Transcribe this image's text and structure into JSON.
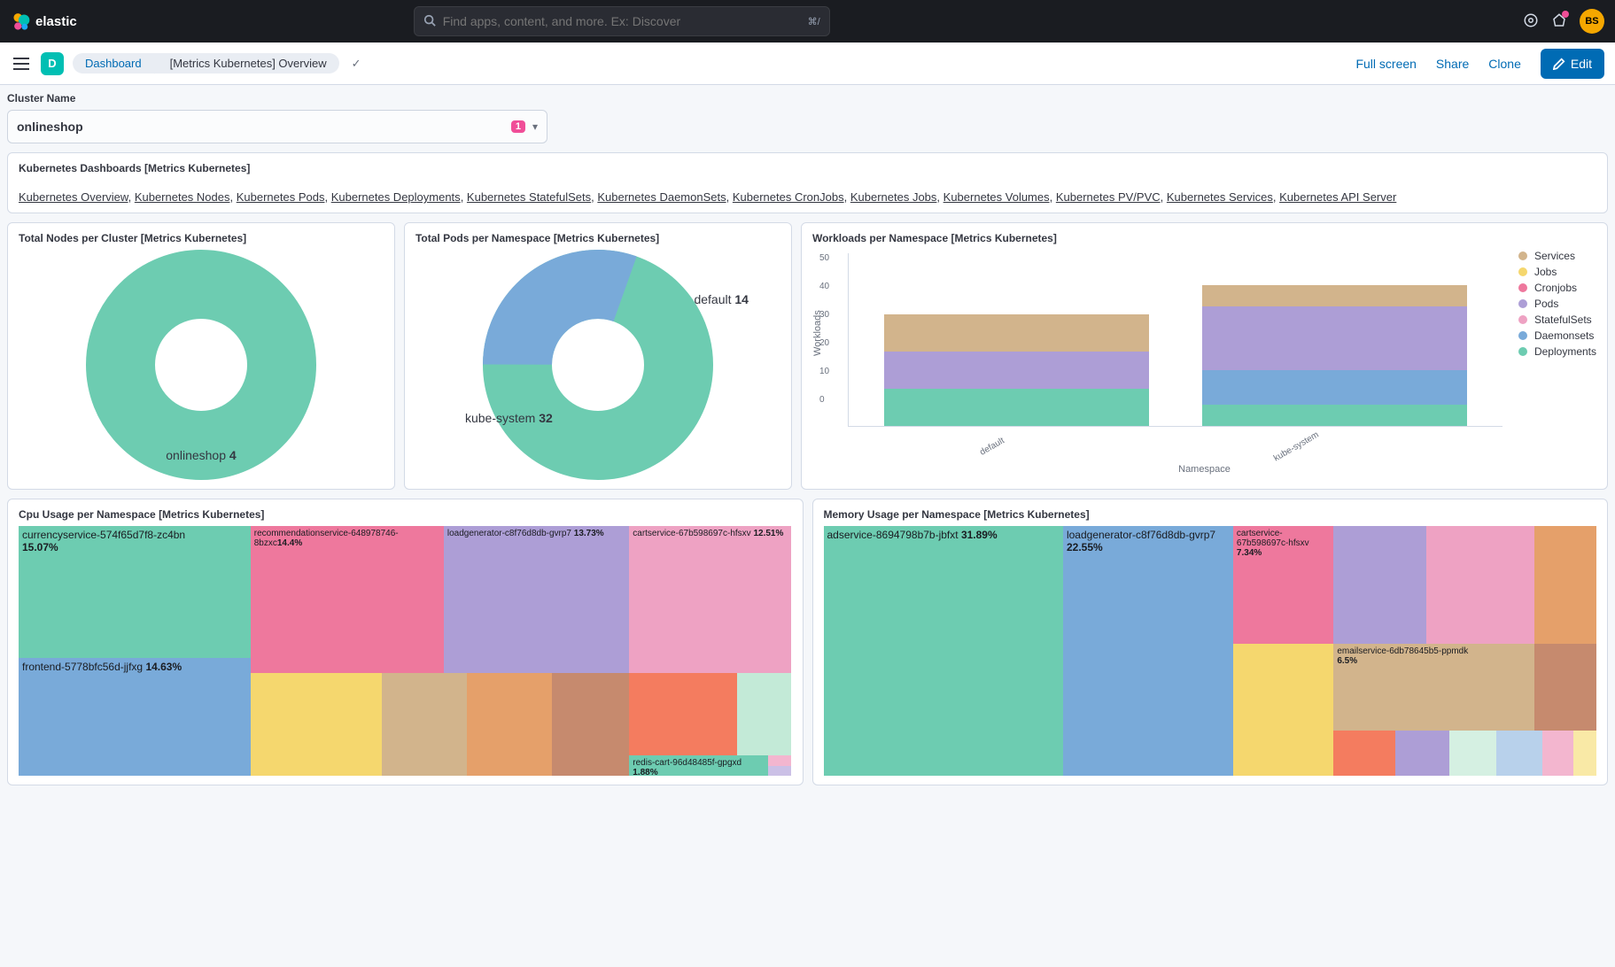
{
  "topnav": {
    "brand": "elastic",
    "search_placeholder": "Find apps, content, and more. Ex: Discover",
    "kbd": "⌘/",
    "avatar": "BS"
  },
  "subheader": {
    "space_badge": "D",
    "breadcrumb_root": "Dashboard",
    "breadcrumb_current": "[Metrics Kubernetes] Overview",
    "actions": {
      "full_screen": "Full screen",
      "share": "Share",
      "clone": "Clone",
      "edit": "Edit"
    }
  },
  "filter": {
    "label": "Cluster Name",
    "value": "onlineshop",
    "badge": "1"
  },
  "links_panel": {
    "title": "Kubernetes Dashboards [Metrics Kubernetes]",
    "links": [
      "Kubernetes Overview",
      "Kubernetes Nodes",
      "Kubernetes Pods",
      "Kubernetes Deployments",
      "Kubernetes StatefulSets",
      "Kubernetes DaemonSets",
      "Kubernetes CronJobs",
      "Kubernetes Jobs",
      "Kubernetes Volumes",
      "Kubernetes PV/PVC",
      "Kubernetes Services",
      "Kubernetes API Server"
    ]
  },
  "panels": {
    "nodes": {
      "title": "Total Nodes per Cluster [Metrics Kubernetes]",
      "label_text": "onlineshop ",
      "label_value": "4"
    },
    "pods": {
      "title": "Total Pods per Namespace [Metrics Kubernetes]",
      "label1_text": "kube-system ",
      "label1_value": "32",
      "label2_text": "default ",
      "label2_value": "14"
    },
    "workloads": {
      "title": "Workloads per Namespace [Metrics Kubernetes]",
      "yaxis": "Workloads",
      "xaxis": "Namespace",
      "cat1": "default",
      "cat2": "kube-system",
      "legend": {
        "services": "Services",
        "jobs": "Jobs",
        "cronjobs": "Cronjobs",
        "pods": "Pods",
        "statefulsets": "StatefulSets",
        "daemonsets": "Daemonsets",
        "deployments": "Deployments"
      }
    },
    "cpu": {
      "title": "Cpu Usage per Namespace [Metrics Kubernetes]",
      "c1_n": "currencyservice-574f65d7f8-zc4bn",
      "c1_p": "15.07%",
      "c2_n": "frontend-5778bfc56d-jjfxg ",
      "c2_p": "14.63%",
      "c3_n": "recommendationservice-648978746-8bzxc",
      "c3_p": "14.4%",
      "c4_n": "loadgenerator-c8f76d8db-gvrp7 ",
      "c4_p": "13.73%",
      "c5_n": "cartservice-67b598697c-hfsxv ",
      "c5_p": "12.51%",
      "c6_n": "redis-cart-96d48485f-gpgxd",
      "c6_p": "1.88%"
    },
    "mem": {
      "title": "Memory Usage per Namespace [Metrics Kubernetes]",
      "m1_n": "adservice-8694798b7b-jbfxt ",
      "m1_p": "31.89%",
      "m2_n": "loadgenerator-c8f76d8db-gvrp7",
      "m2_p": "22.55%",
      "m3_n": "cartservice-67b598697c-hfsxv",
      "m3_p": "7.34%",
      "m4_n": "emailservice-6db78645b5-ppmdk",
      "m4_p": "6.5%"
    }
  },
  "chart_data": [
    {
      "type": "pie",
      "title": "Total Nodes per Cluster [Metrics Kubernetes]",
      "categories": [
        "onlineshop"
      ],
      "values": [
        4
      ]
    },
    {
      "type": "pie",
      "title": "Total Pods per Namespace [Metrics Kubernetes]",
      "categories": [
        "kube-system",
        "default"
      ],
      "values": [
        32,
        14
      ]
    },
    {
      "type": "bar",
      "title": "Workloads per Namespace [Metrics Kubernetes]",
      "xlabel": "Namespace",
      "ylabel": "Workloads",
      "ylim": [
        0,
        55
      ],
      "categories": [
        "default",
        "kube-system"
      ],
      "series": [
        {
          "name": "Deployments",
          "values": [
            14,
            8
          ]
        },
        {
          "name": "Daemonsets",
          "values": [
            0,
            13
          ]
        },
        {
          "name": "StatefulSets",
          "values": [
            0,
            0
          ]
        },
        {
          "name": "Pods",
          "values": [
            14,
            24
          ]
        },
        {
          "name": "Cronjobs",
          "values": [
            0,
            0
          ]
        },
        {
          "name": "Jobs",
          "values": [
            0,
            0
          ]
        },
        {
          "name": "Services",
          "values": [
            14,
            8
          ]
        }
      ]
    },
    {
      "type": "treemap",
      "title": "Cpu Usage per Namespace [Metrics Kubernetes]",
      "series": [
        {
          "name": "currencyservice-574f65d7f8-zc4bn",
          "value": 15.07
        },
        {
          "name": "frontend-5778bfc56d-jjfxg",
          "value": 14.63
        },
        {
          "name": "recommendationservice-648978746-8bzxc",
          "value": 14.4
        },
        {
          "name": "loadgenerator-c8f76d8db-gvrp7",
          "value": 13.73
        },
        {
          "name": "cartservice-67b598697c-hfsxv",
          "value": 12.51
        },
        {
          "name": "redis-cart-96d48485f-gpgxd",
          "value": 1.88
        }
      ]
    },
    {
      "type": "treemap",
      "title": "Memory Usage per Namespace [Metrics Kubernetes]",
      "series": [
        {
          "name": "adservice-8694798b7b-jbfxt",
          "value": 31.89
        },
        {
          "name": "loadgenerator-c8f76d8db-gvrp7",
          "value": 22.55
        },
        {
          "name": "cartservice-67b598697c-hfsxv",
          "value": 7.34
        },
        {
          "name": "emailservice-6db78645b5-ppmdk",
          "value": 6.5
        }
      ]
    }
  ]
}
